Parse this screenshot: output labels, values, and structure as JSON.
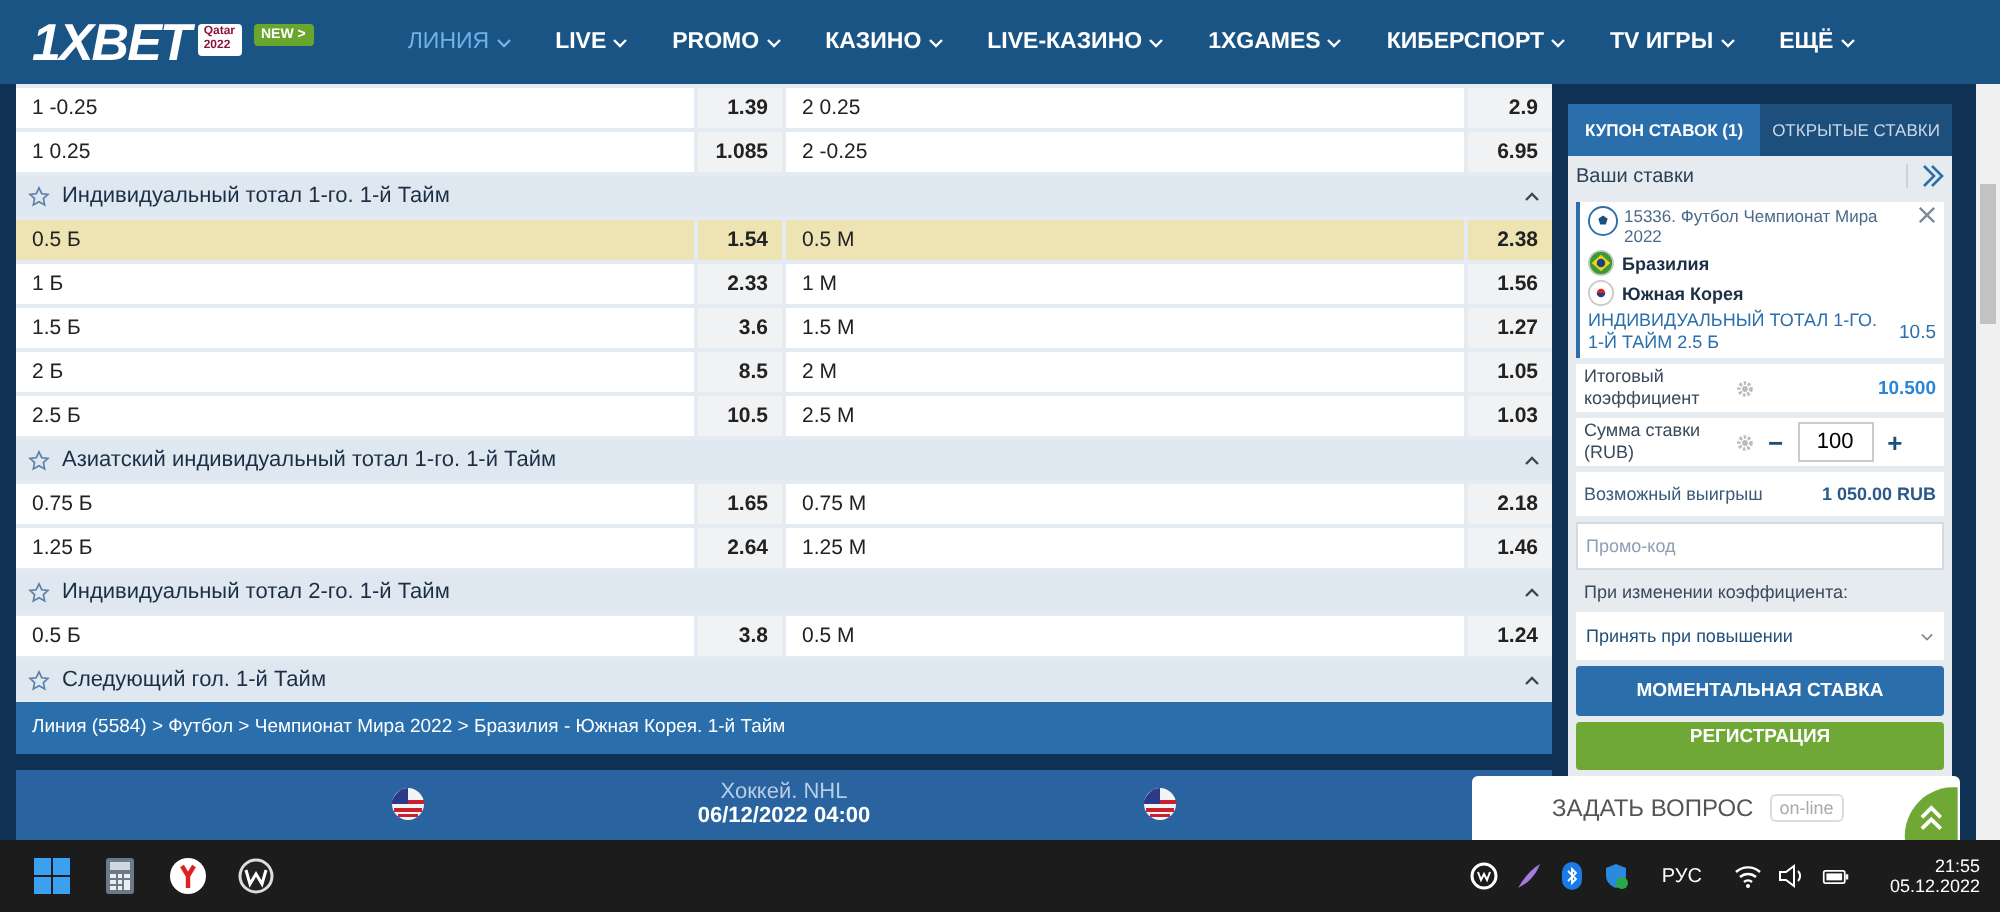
{
  "header": {
    "logo": "1XBET",
    "logo_badge": [
      "Qatar",
      "2022"
    ],
    "new_badge": "NEW >",
    "nav": [
      {
        "label": "ЛИНИЯ",
        "selected": true
      },
      {
        "label": "LIVE",
        "selected": false
      },
      {
        "label": "PROMO",
        "selected": false
      },
      {
        "label": "КАЗИНО",
        "selected": false
      },
      {
        "label": "LIVE-КАЗИНО",
        "selected": false
      },
      {
        "label": "1XGAMES",
        "selected": false
      },
      {
        "label": "КИБЕРСПОРТ",
        "selected": false
      },
      {
        "label": "TV ИГРЫ",
        "selected": false
      },
      {
        "label": "ЕЩЁ",
        "selected": false
      }
    ]
  },
  "markets": [
    {
      "kind": "row",
      "left": "1 -0.25",
      "left_odd": "1.39",
      "right": "2 0.25",
      "right_odd": "2.9",
      "selected": false
    },
    {
      "kind": "row",
      "left": "1 0.25",
      "left_odd": "1.085",
      "right": "2 -0.25",
      "right_odd": "6.95",
      "selected": false
    },
    {
      "kind": "header",
      "title": "Индивидуальный тотал 1-го. 1-й Тайм",
      "expanded": true
    },
    {
      "kind": "row",
      "left": "0.5 Б",
      "left_odd": "1.54",
      "right": "0.5 М",
      "right_odd": "2.38",
      "selected": true
    },
    {
      "kind": "row",
      "left": "1 Б",
      "left_odd": "2.33",
      "right": "1 М",
      "right_odd": "1.56",
      "selected": false
    },
    {
      "kind": "row",
      "left": "1.5 Б",
      "left_odd": "3.6",
      "right": "1.5 М",
      "right_odd": "1.27",
      "selected": false
    },
    {
      "kind": "row",
      "left": "2 Б",
      "left_odd": "8.5",
      "right": "2 М",
      "right_odd": "1.05",
      "selected": false
    },
    {
      "kind": "row",
      "left": "2.5 Б",
      "left_odd": "10.5",
      "right": "2.5 М",
      "right_odd": "1.03",
      "selected": false
    },
    {
      "kind": "header",
      "title": "Азиатский индивидуальный тотал 1-го. 1-й Тайм",
      "expanded": true
    },
    {
      "kind": "row",
      "left": "0.75 Б",
      "left_odd": "1.65",
      "right": "0.75 М",
      "right_odd": "2.18",
      "selected": false
    },
    {
      "kind": "row",
      "left": "1.25 Б",
      "left_odd": "2.64",
      "right": "1.25 М",
      "right_odd": "1.46",
      "selected": false
    },
    {
      "kind": "header",
      "title": "Индивидуальный тотал 2-го. 1-й Тайм",
      "expanded": true
    },
    {
      "kind": "row",
      "left": "0.5 Б",
      "left_odd": "3.8",
      "right": "0.5 М",
      "right_odd": "1.24",
      "selected": false
    },
    {
      "kind": "header",
      "title": "Следующий гол. 1-й Тайм",
      "expanded": true
    }
  ],
  "breadcrumb": "Линия (5584) > Футбол > Чемпионат Мира 2022 > Бразилия - Южная Корея. 1-й Тайм",
  "banner": {
    "sport": "Хоккей. NHL",
    "date": "06/12/2022 04:00"
  },
  "coupon": {
    "tabs": [
      {
        "label": "КУПОН СТАВОК (1)",
        "selected": true
      },
      {
        "label": "ОТКРЫТЫЕ СТАВКИ",
        "selected": false
      }
    ],
    "your_bets": "Ваши ставки",
    "bet": {
      "event": "15336. Футбол Чемпионат Мира 2022",
      "team1": "Бразилия",
      "team2": "Южная Корея",
      "market": "ИНДИВИДУАЛЬНЫЙ ТОТАЛ 1-ГО. 1-Й ТАЙМ 2.5 Б",
      "odd": "10.5"
    },
    "total_label": "Итоговый коэффициент",
    "total": "10.500",
    "stake_label": "Сумма ставки (RUB)",
    "minus": "−",
    "stake": "100",
    "plus": "+",
    "win_label": "Возможный выигрыш",
    "win": "1 050.00 RUB",
    "promo_placeholder": "Промо-код",
    "change_label": "При изменении коэффициента:",
    "change_option": "Принять при повышении",
    "quick_bet": "МОМЕНТАЛЬНАЯ СТАВКА",
    "register": "РЕГИСТРАЦИЯ"
  },
  "chat": {
    "label": "ЗАДАТЬ ВОПРОС",
    "status": "on-line"
  },
  "taskbar": {
    "lang": "РУС",
    "time": "21:55",
    "date": "05.12.2022"
  }
}
